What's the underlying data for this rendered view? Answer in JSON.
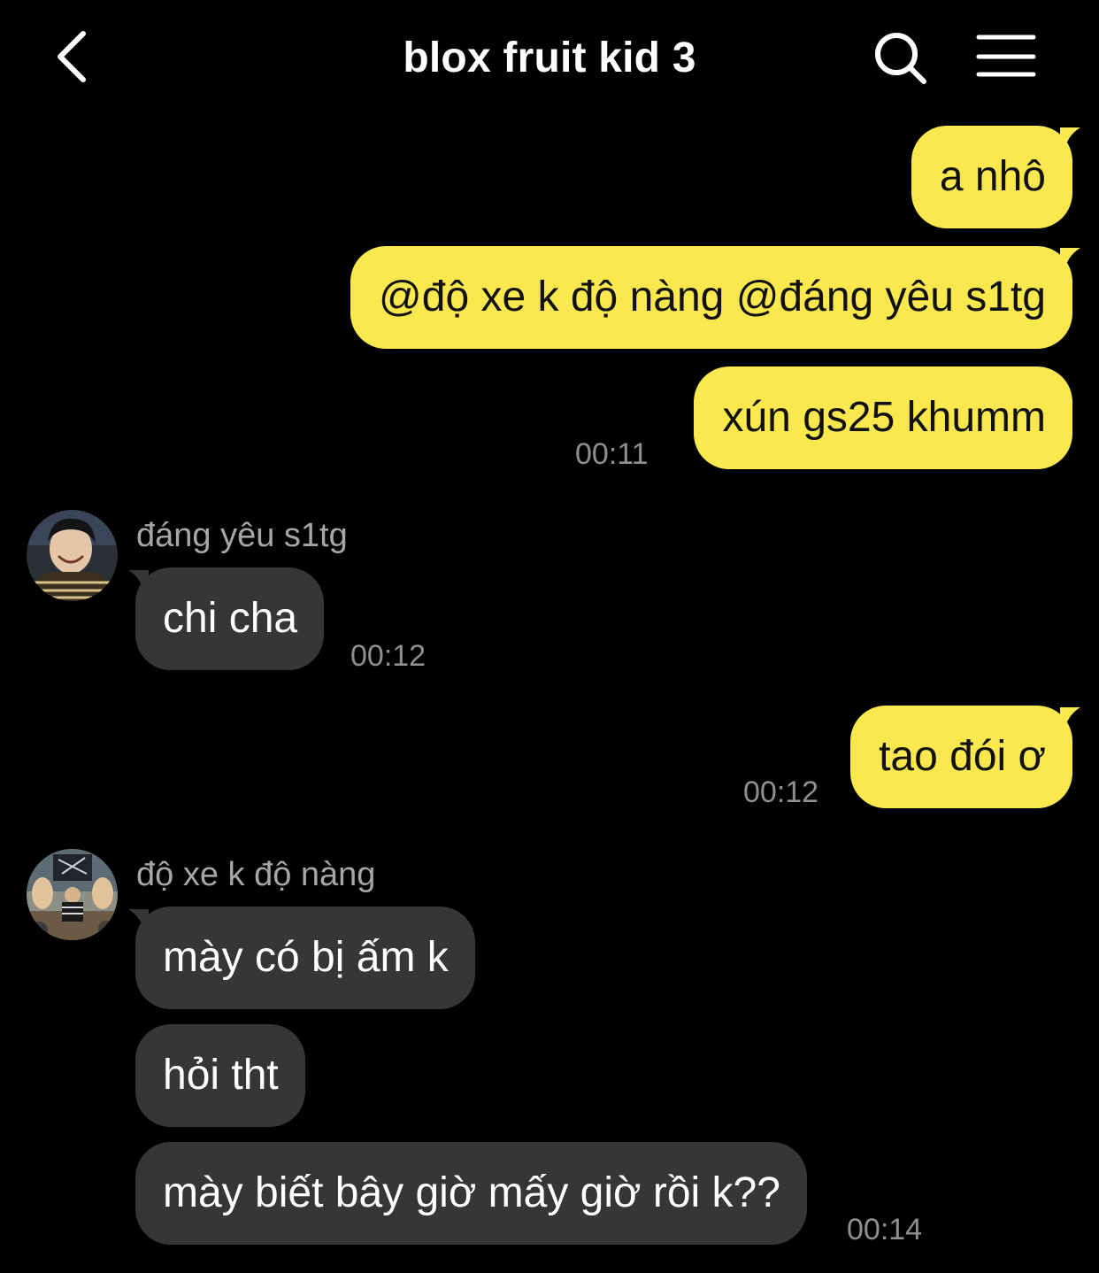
{
  "header": {
    "title": "blox fruit kid 3",
    "back_icon": "chevron-left-icon",
    "search_icon": "search-icon",
    "menu_icon": "hamburger-menu-icon"
  },
  "colors": {
    "background": "#000000",
    "outgoing_bubble": "#FAE84E",
    "incoming_bubble": "#363638",
    "timestamp": "#8E8E93",
    "sender_name": "#A6A6AA"
  },
  "messages": {
    "m1": {
      "text": "a nhô"
    },
    "m2": {
      "text": "@độ xe k độ nàng @đáng yêu s1tg"
    },
    "m3": {
      "text": "xún gs25 khumm",
      "time": "00:11"
    },
    "m4": {
      "sender": "đáng yêu s1tg",
      "text": "chi cha",
      "time": "00:12"
    },
    "m5": {
      "text": "tao đói ơ",
      "time": "00:12"
    },
    "m6": {
      "sender": "độ xe k độ nàng",
      "text": "mày có bị ấm k"
    },
    "m7": {
      "text": "hỏi tht"
    },
    "m8": {
      "text": "mày biết bây giờ mấy giờ rồi k??",
      "time": "00:14"
    }
  }
}
